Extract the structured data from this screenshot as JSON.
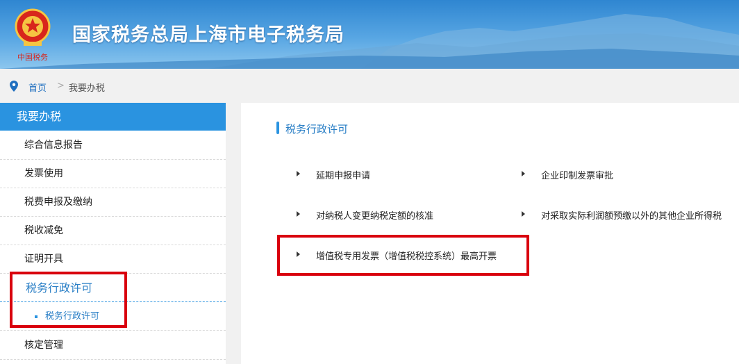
{
  "header": {
    "title": "国家税务总局上海市电子税务局",
    "emblem_caption": "中国税务",
    "colors": {
      "banner_top": "#2f86d1",
      "banner_bottom": "#8cc6ee"
    }
  },
  "breadcrumb": {
    "icon": "location-pin-icon",
    "home": "首页",
    "separator": ">",
    "current": "我要办税"
  },
  "sidebar": {
    "heading": "我要办税",
    "items": [
      {
        "label": "综合信息报告"
      },
      {
        "label": "发票使用"
      },
      {
        "label": "税费申报及缴纳"
      },
      {
        "label": "税收减免"
      },
      {
        "label": "证明开具"
      },
      {
        "label": "税务行政许可",
        "active": true
      },
      {
        "label": "核定管理"
      }
    ],
    "sub_item": {
      "label": "税务行政许可"
    }
  },
  "main": {
    "section_title": "税务行政许可",
    "links": [
      {
        "label": "延期申报申请"
      },
      {
        "label": "企业印制发票审批"
      },
      {
        "label": "对纳税人变更纳税定额的核准"
      },
      {
        "label": "对采取实际利润额预缴以外的其他企业所得税"
      },
      {
        "label": "增值税专用发票（增值税税控系统）最高开票"
      }
    ]
  },
  "colors": {
    "accent": "#2a93e0",
    "highlight": "#d9000d"
  }
}
